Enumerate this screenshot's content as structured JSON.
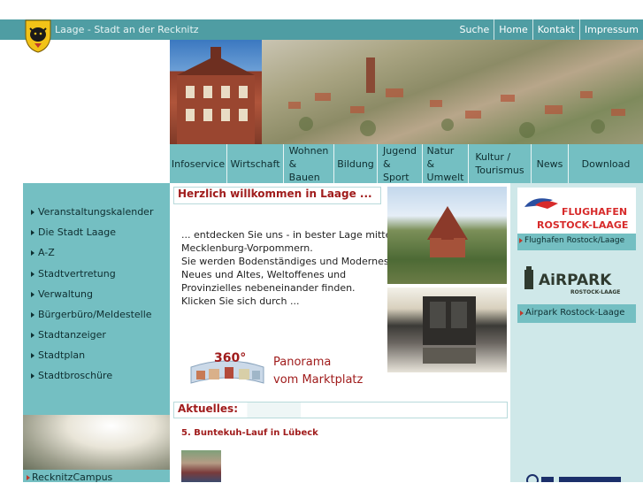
{
  "header": {
    "site_title": "Laage - Stadt an der Recknitz",
    "top_nav": [
      "Suche",
      "Home",
      "Kontakt",
      "Impressum"
    ]
  },
  "main_nav": [
    {
      "line1": "Infoservice",
      "line2": ""
    },
    {
      "line1": "Wirtschaft",
      "line2": ""
    },
    {
      "line1": "Wohnen",
      "line2": "& Bauen"
    },
    {
      "line1": "Bildung",
      "line2": ""
    },
    {
      "line1": "Jugend",
      "line2": "& Sport"
    },
    {
      "line1": "Natur &",
      "line2": "Umwelt"
    },
    {
      "line1": "Kultur /",
      "line2": "Tourismus"
    },
    {
      "line1": "News",
      "line2": ""
    },
    {
      "line1": "Download",
      "line2": ""
    }
  ],
  "left_nav": [
    "Veranstaltungskalender",
    "Die Stadt Laage",
    "A-Z",
    "Stadtvertretung",
    "Verwaltung",
    "Bürgerbüro/Meldestelle",
    "Stadtanzeiger",
    "Stadtplan",
    "Stadtbroschüre"
  ],
  "campus_label": "RecknitzCampus",
  "welcome": {
    "title": "Herzlich willkommen in Laage ...",
    "lines": [
      "... entdecken Sie uns - in bester Lage mitten in",
      "Mecklenburg-Vorpommern.",
      "Sie werden Bodenständiges und Modernes,",
      "Neues und Altes, Weltoffenes und",
      "Provinzielles nebeneinander finden.",
      "Klicken Sie sich durch ..."
    ]
  },
  "panorama": {
    "badge": "360°",
    "line1": "Panorama",
    "line2": "vom Marktplatz"
  },
  "news": {
    "section_title": "Aktuelles:",
    "headline": "5. Buntekuh-Lauf in Lübeck"
  },
  "right": {
    "flughafen_logo_line1": "FLUGHAFEN",
    "flughafen_logo_line2": "ROSTOCK-LAAGE",
    "flughafen_link": "Flughafen Rostock/Laage",
    "airpark_logo_line1": "AiRPARK",
    "airpark_logo_line2": "ROSTOCK-LAAGE",
    "airpark_link": "Airpark Rostock-Laage"
  },
  "colors": {
    "teal": "#74bfc2",
    "topbar": "#4f9da3",
    "accent_red": "#a01c1c",
    "light_teal": "#cfe8e9"
  }
}
